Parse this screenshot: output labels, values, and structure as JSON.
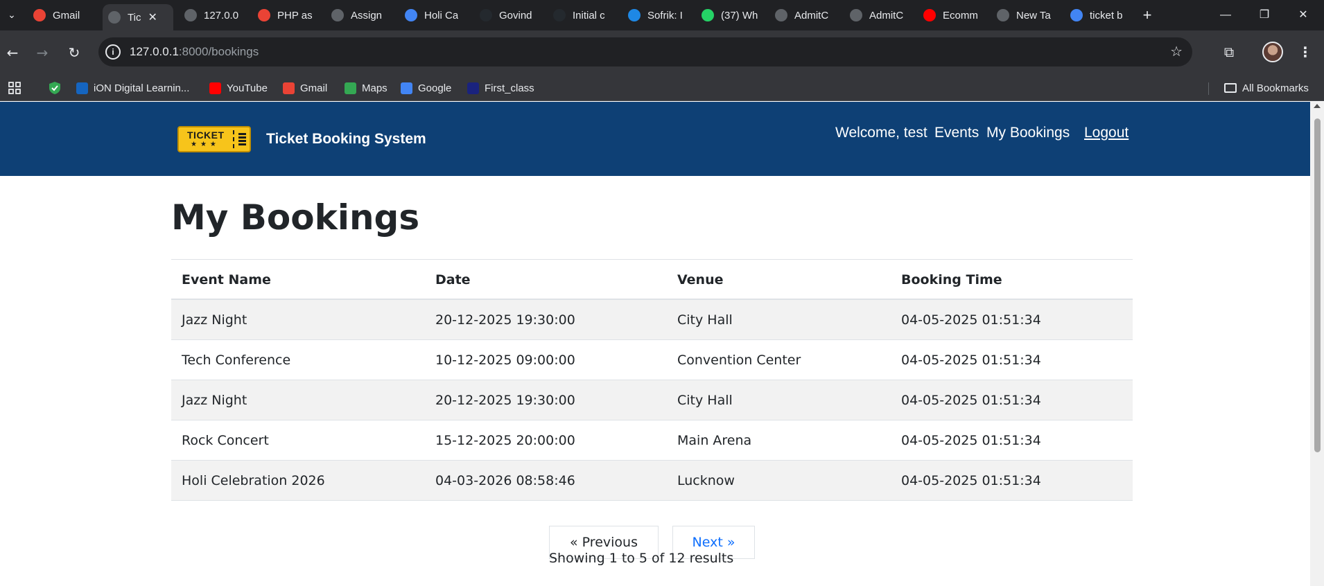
{
  "browser": {
    "tabs": [
      {
        "label": "Gmail",
        "icon": "gmail-icon",
        "color": "#ea4335"
      },
      {
        "label": "Tic",
        "icon": "globe-icon",
        "color": "#5f6368",
        "active": true
      },
      {
        "label": "127.0.0",
        "icon": "globe-icon",
        "color": "#5f6368"
      },
      {
        "label": "PHP as",
        "icon": "gmail-icon",
        "color": "#ea4335"
      },
      {
        "label": "Assign",
        "icon": "globe-icon",
        "color": "#5f6368"
      },
      {
        "label": "Holi Ca",
        "icon": "google-icon",
        "color": "#4285f4"
      },
      {
        "label": "Govind",
        "icon": "github-icon",
        "color": "#24292e"
      },
      {
        "label": "Initial c",
        "icon": "github-icon",
        "color": "#24292e"
      },
      {
        "label": "Sofrik: I",
        "icon": "sofrik-icon",
        "color": "#1e88e5"
      },
      {
        "label": "(37) Wh",
        "icon": "whatsapp-icon",
        "color": "#25d366"
      },
      {
        "label": "AdmitC",
        "icon": "globe-icon",
        "color": "#5f6368"
      },
      {
        "label": "AdmitC",
        "icon": "globe-icon",
        "color": "#5f6368"
      },
      {
        "label": "Ecomm",
        "icon": "youtube-icon",
        "color": "#ff0000"
      },
      {
        "label": "New Ta",
        "icon": "chrome-icon",
        "color": "#5f6368"
      },
      {
        "label": "ticket b",
        "icon": "google-icon",
        "color": "#4285f4"
      }
    ],
    "url_host": "127.0.0.1",
    "url_path": ":8000/bookings",
    "bookmarks": [
      {
        "label": "iON Digital Learnin...",
        "icon": "ion-icon",
        "color": "#1565c0"
      },
      {
        "label": "YouTube",
        "icon": "youtube-icon",
        "color": "#ff0000"
      },
      {
        "label": "Gmail",
        "icon": "gmail-icon",
        "color": "#ea4335"
      },
      {
        "label": "Maps",
        "icon": "maps-icon",
        "color": "#34a853"
      },
      {
        "label": "Google",
        "icon": "google-icon",
        "color": "#4285f4"
      },
      {
        "label": "First_class",
        "icon": "first-class-icon",
        "color": "#1a237e"
      }
    ],
    "all_bookmarks": "All Bookmarks"
  },
  "site": {
    "logo_text": "TICKET",
    "title": "Ticket Booking System",
    "nav": {
      "welcome": "Welcome, test",
      "events": "Events",
      "my_bookings": "My Bookings",
      "logout": "Logout"
    },
    "header_color": "#0e4075"
  },
  "page": {
    "title": "My Bookings",
    "columns": [
      "Event Name",
      "Date",
      "Venue",
      "Booking Time"
    ],
    "rows": [
      [
        "Jazz Night",
        "20-12-2025 19:30:00",
        "City Hall",
        "04-05-2025 01:51:34"
      ],
      [
        "Tech Conference",
        "10-12-2025 09:00:00",
        "Convention Center",
        "04-05-2025 01:51:34"
      ],
      [
        "Jazz Night",
        "20-12-2025 19:30:00",
        "City Hall",
        "04-05-2025 01:51:34"
      ],
      [
        "Rock Concert",
        "15-12-2025 20:00:00",
        "Main Arena",
        "04-05-2025 01:51:34"
      ],
      [
        "Holi Celebration 2026",
        "04-03-2026 08:58:46",
        "Lucknow",
        "04-05-2025 01:51:34"
      ]
    ],
    "pagination": {
      "previous": "« Previous",
      "next": "Next »",
      "summary": "Showing 1 to 5 of 12 results"
    }
  }
}
